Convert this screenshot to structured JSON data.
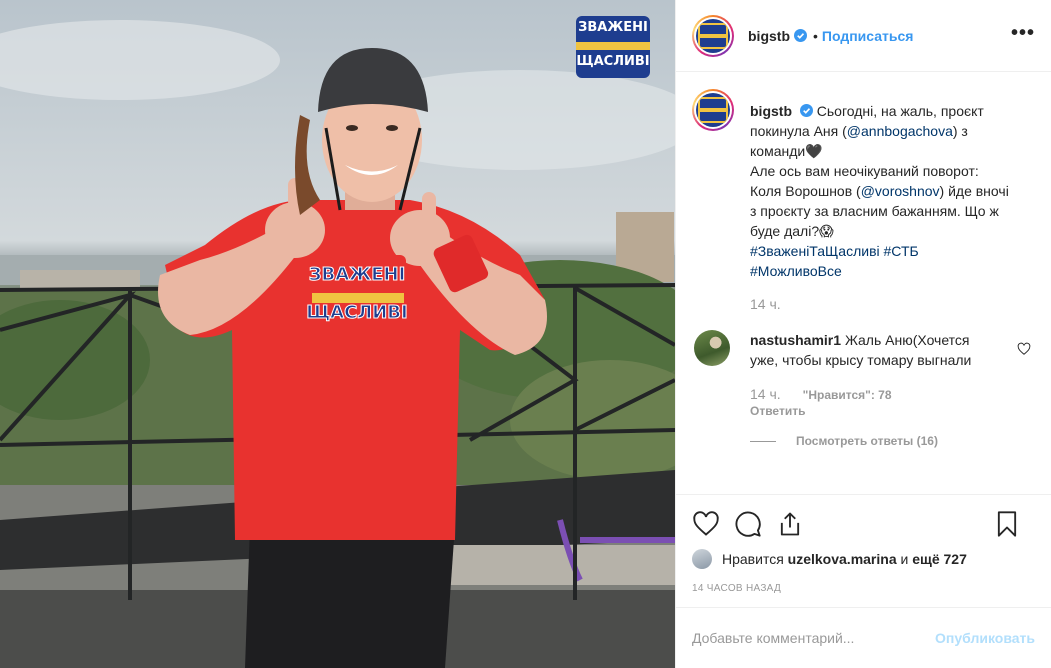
{
  "post": {
    "username": "bigstb",
    "dot": "•",
    "follow_label": "Подписаться",
    "more_label": "•••",
    "show_logo_text": [
      "ЗВАЖЕНІ",
      "ЩАСЛИВІ"
    ],
    "caption": {
      "username": "bigstb",
      "text_1": "Сьогодні, на жаль, проєкт покинула Аня (",
      "mention_1": "@annbogachova",
      "text_2": ") з команди🖤",
      "text_3": "Але ось вам неочікуваний поворот: Коля Ворошнов (",
      "mention_2": "@voroshnov",
      "text_4": ") йде вночі з проєкту за власним бажанням. Що ж буде далі?😱",
      "hashtag_1": "#ЗваженіТаЩасливі",
      "hashtag_2": "#СТБ",
      "hashtag_3": "#МожливоВсе",
      "time": "14 ч."
    },
    "comment": {
      "username": "nastushamir1",
      "text": "Жаль Аню(Хочется уже, чтобы крысу томару выгнали",
      "time": "14 ч.",
      "likes": "\"Нравится\": 78",
      "reply_label": "Ответить",
      "view_replies": "Посмотреть ответы (16)"
    },
    "likes": {
      "prefix": "Нравится",
      "user": "uzelkova.marina",
      "middle": "и",
      "rest": "ещё 727"
    },
    "timestamp": "14 часов назад",
    "add_comment": {
      "placeholder": "Добавьте комментарий...",
      "publish_label": "Опубликовать"
    }
  },
  "colors": {
    "link": "#3897f0",
    "mention": "#003569",
    "muted": "#999999",
    "publish_disabled": "#b2dffc",
    "shirt": "#e8322f"
  },
  "icons": [
    "heart-icon",
    "comment-icon",
    "share-icon",
    "bookmark-icon",
    "verified-icon",
    "more-icon"
  ]
}
